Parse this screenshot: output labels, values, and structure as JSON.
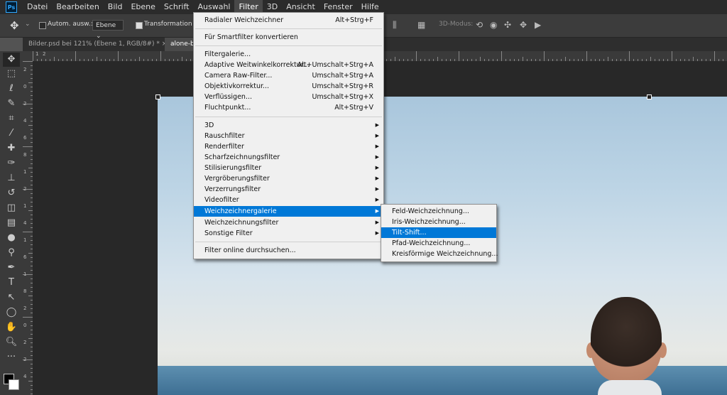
{
  "app": {
    "logo": "Ps"
  },
  "menubar": {
    "items": [
      "Datei",
      "Bearbeiten",
      "Bild",
      "Ebene",
      "Schrift",
      "Auswahl",
      "Filter",
      "3D",
      "Ansicht",
      "Fenster",
      "Hilfe"
    ],
    "active": "Filter"
  },
  "options": {
    "auto_select_label": "Autom. ausw.:",
    "layer_select": "Ebene",
    "transform_label": "Transformationsstrg.",
    "mode_3d_label": "3D-Modus:"
  },
  "tabs": [
    {
      "label": "Bilder.psd bei 121% (Ebene 1, RGB/8#) *",
      "close": "×"
    },
    {
      "label": "alone-ba"
    }
  ],
  "ruler": {
    "h_labels": [
      "1",
      "2"
    ],
    "v_labels": [
      "2",
      "0",
      "2",
      "4",
      "6",
      "8",
      "1",
      "2",
      "1",
      "4",
      "1",
      "6",
      "1",
      "8",
      "2",
      "0",
      "2",
      "2",
      "4"
    ]
  },
  "filter_menu": {
    "items": [
      {
        "label": "Radialer Weichzeichner",
        "shortcut": "Alt+Strg+F"
      },
      {
        "label": "Für Smartfilter konvertieren",
        "shortcut": ""
      },
      {
        "label": "Filtergalerie...",
        "shortcut": ""
      },
      {
        "label": "Adaptive Weitwinkelkorrektur...",
        "shortcut": "Alt+Umschalt+Strg+A"
      },
      {
        "label": "Camera Raw-Filter...",
        "shortcut": "Umschalt+Strg+A"
      },
      {
        "label": "Objektivkorrektur...",
        "shortcut": "Umschalt+Strg+R"
      },
      {
        "label": "Verflüssigen...",
        "shortcut": "Umschalt+Strg+X"
      },
      {
        "label": "Fluchtpunkt...",
        "shortcut": "Alt+Strg+V"
      },
      {
        "label": "3D",
        "submenu": true
      },
      {
        "label": "Rauschfilter",
        "submenu": true
      },
      {
        "label": "Renderfilter",
        "submenu": true
      },
      {
        "label": "Scharfzeichnungsfilter",
        "submenu": true
      },
      {
        "label": "Stilisierungsfilter",
        "submenu": true
      },
      {
        "label": "Vergröberungsfilter",
        "submenu": true
      },
      {
        "label": "Verzerrungsfilter",
        "submenu": true
      },
      {
        "label": "Videofilter",
        "submenu": true
      },
      {
        "label": "Weichzeichnergalerie",
        "submenu": true,
        "highlighted": true
      },
      {
        "label": "Weichzeichnungsfilter",
        "submenu": true
      },
      {
        "label": "Sonstige Filter",
        "submenu": true
      },
      {
        "label": "Filter online durchsuchen...",
        "shortcut": ""
      }
    ]
  },
  "blur_gallery_submenu": {
    "items": [
      {
        "label": "Feld-Weichzeichnung..."
      },
      {
        "label": "Iris-Weichzeichnung..."
      },
      {
        "label": "Tilt-Shift...",
        "highlighted": true
      },
      {
        "label": "Pfad-Weichzeichnung..."
      },
      {
        "label": "Kreisförmige Weichzeichnung..."
      }
    ]
  },
  "colors": {
    "menu_highlight": "#0078d7",
    "chrome_dark": "#2b2b2b",
    "menu_bg": "#f0f0f0"
  }
}
